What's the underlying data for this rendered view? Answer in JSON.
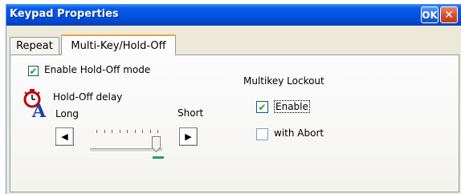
{
  "window": {
    "title": "Keypad Properties",
    "ok_label": "OK",
    "close_label": "✕"
  },
  "tabs": [
    {
      "label": "Repeat",
      "active": false
    },
    {
      "label": "Multi-Key/Hold-Off",
      "active": true
    }
  ],
  "hold_off": {
    "enable_label": "Enable Hold-Off mode",
    "enable_checked": true,
    "delay_label": "Hold-Off delay",
    "long_label": "Long",
    "short_label": "Short",
    "slider_value": 1.0,
    "slider_ticks": 9,
    "left_arrow": "◀",
    "right_arrow": "▶"
  },
  "multikey": {
    "heading": "Multikey Lockout",
    "enable_label": "Enable",
    "enable_checked": true,
    "abort_label": "with Abort",
    "abort_checked": false
  },
  "colors": {
    "titlebar": "#0054e3",
    "check": "#21a121",
    "active_tab_accent": "#e8a33d"
  }
}
